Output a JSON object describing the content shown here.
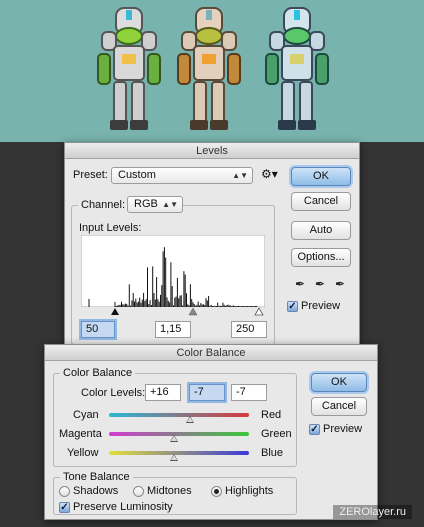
{
  "levels": {
    "title": "Levels",
    "preset_label": "Preset:",
    "preset_value": "Custom",
    "channel_label": "Channel:",
    "channel_value": "RGB",
    "input_levels_label": "Input Levels:",
    "input_black": "50",
    "input_gamma": "1,15",
    "input_white": "250",
    "ok_label": "OK",
    "cancel_label": "Cancel",
    "auto_label": "Auto",
    "options_label": "Options...",
    "preview_label": "Preview",
    "preview_checked": true
  },
  "color_balance": {
    "title": "Color Balance",
    "group_title": "Color Balance",
    "color_levels_label": "Color Levels:",
    "level_1": "+16",
    "level_2": "-7",
    "level_3": "-7",
    "rows": [
      {
        "left": "Cyan",
        "right": "Red",
        "value": 16
      },
      {
        "left": "Magenta",
        "right": "Green",
        "value": -7
      },
      {
        "left": "Yellow",
        "right": "Blue",
        "value": -7
      }
    ],
    "tone_balance_title": "Tone Balance",
    "tone_options": [
      "Shadows",
      "Midtones",
      "Highlights"
    ],
    "tone_selected": "Highlights",
    "preserve_luminosity_label": "Preserve Luminosity",
    "preserve_luminosity_checked": true,
    "ok_label": "OK",
    "cancel_label": "Cancel",
    "preview_label": "Preview",
    "preview_checked": true
  },
  "watermark": "ZEROlayer.ru",
  "colors": {
    "art_background": "#79b3ad",
    "app_background": "#343434",
    "dialog_background": "#e8e8e8",
    "default_button": "#8fbce8"
  }
}
